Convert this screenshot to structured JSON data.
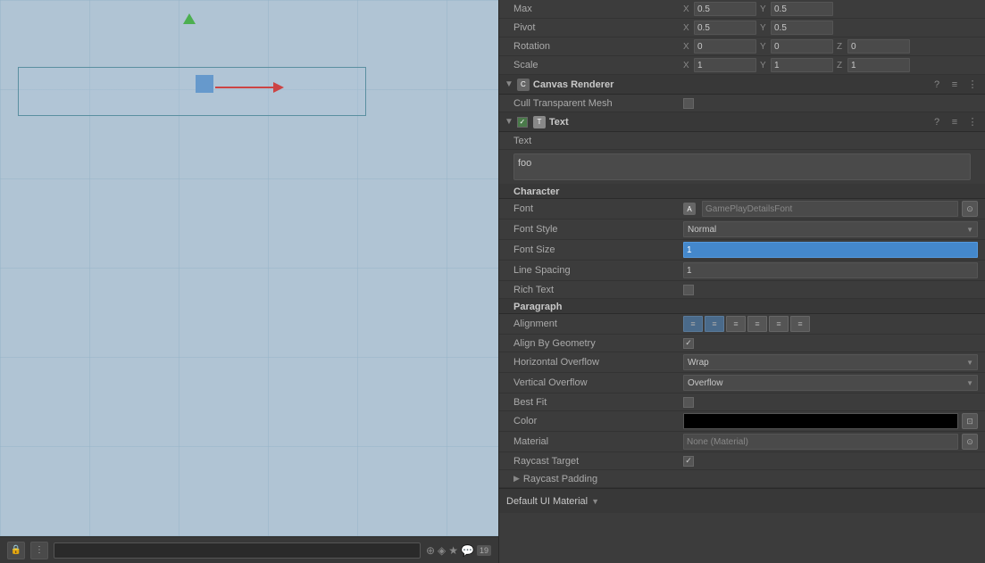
{
  "scene": {
    "background_color": "#b0c4d4"
  },
  "toolbar": {
    "search_placeholder": "",
    "tag_count": "19"
  },
  "inspector": {
    "transform": {
      "max_label": "Max",
      "max_x": "0.5",
      "max_y": "0.5",
      "pivot_label": "Pivot",
      "pivot_x": "0.5",
      "pivot_y": "0.5",
      "rotation_label": "Rotation",
      "rotation_x": "0",
      "rotation_y": "0",
      "rotation_z": "0",
      "scale_label": "Scale",
      "scale_x": "1",
      "scale_y": "1",
      "scale_z": "1"
    },
    "canvas_renderer": {
      "title": "Canvas Renderer",
      "cull_transparent_mesh_label": "Cull Transparent Mesh"
    },
    "text_component": {
      "title": "Text",
      "text_label": "Text",
      "text_value": "foo",
      "character_label": "Character",
      "font_label": "Font",
      "font_value": "GamePlayDetailsFont",
      "font_style_label": "Font Style",
      "font_style_value": "Normal",
      "font_size_label": "Font Size",
      "font_size_value": "1",
      "line_spacing_label": "Line Spacing",
      "line_spacing_value": "1",
      "rich_text_label": "Rich Text",
      "paragraph_label": "Paragraph",
      "alignment_label": "Alignment",
      "align_by_geometry_label": "Align By Geometry",
      "horizontal_overflow_label": "Horizontal Overflow",
      "horizontal_overflow_value": "Wrap",
      "vertical_overflow_label": "Vertical Overflow",
      "vertical_overflow_value": "Overflow",
      "best_fit_label": "Best Fit",
      "color_label": "Color",
      "material_label": "Material",
      "material_value": "None (Material)",
      "raycast_target_label": "Raycast Target",
      "raycast_padding_label": "Raycast Padding"
    },
    "footer": {
      "label": "Default UI Material"
    }
  },
  "icons": {
    "question": "?",
    "settings": "≡",
    "more": "⋮",
    "arrow_right": "▶",
    "arrow_down": "▼",
    "search": "🔍",
    "lock": "🔒",
    "eye": "👁",
    "font_icon": "A",
    "align_left": "≡",
    "align_center": "≡",
    "align_right": "≡",
    "align_top": "⊤",
    "align_mid": "⊟",
    "align_bot": "⊥",
    "color_picker": "⊡"
  }
}
